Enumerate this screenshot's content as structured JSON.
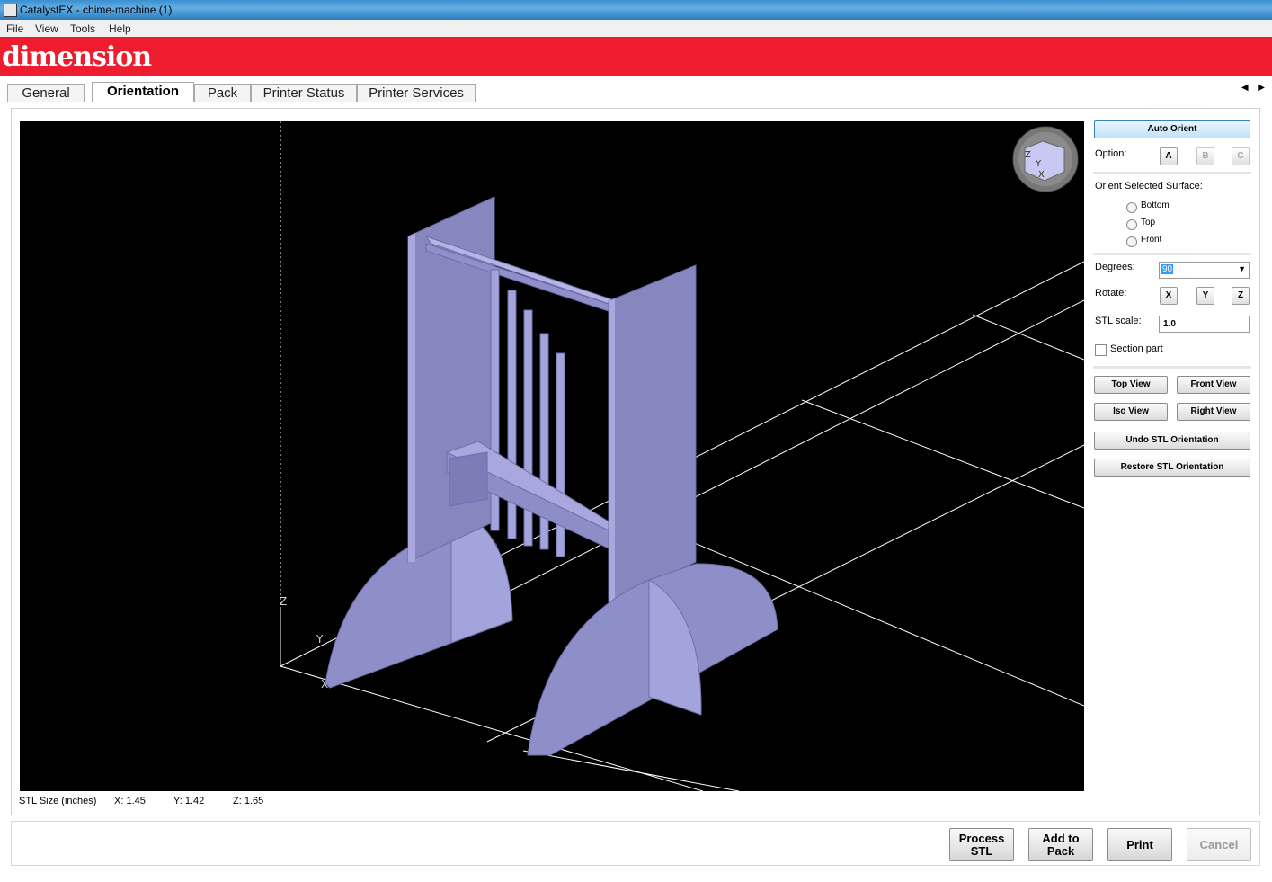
{
  "window": {
    "title": "CatalystEX - chime-machine (1)"
  },
  "menu": [
    "File",
    "View",
    "Tools",
    "Help"
  ],
  "brand": {
    "logo_text": "dimension"
  },
  "tabs": [
    "General",
    "Orientation",
    "Pack",
    "Printer Status",
    "Printer Services"
  ],
  "active_tab": "Orientation",
  "viewport": {
    "axis_labels": {
      "z": "Z",
      "y": "Y",
      "x": "X"
    },
    "cube_labels": [
      "Z",
      "Y",
      "X"
    ]
  },
  "stl_size": {
    "label": "STL Size (inches)",
    "x": "X:  1.45",
    "y": "Y:  1.42",
    "z": "Z:  1.65"
  },
  "panel": {
    "auto_orient": "Auto Orient",
    "option_label": "Option:",
    "options": [
      "A",
      "B",
      "C"
    ],
    "orient_surface_label": "Orient Selected Surface:",
    "surfaces": [
      "Bottom",
      "Top",
      "Front"
    ],
    "degrees_label": "Degrees:",
    "degrees_value": "90",
    "rotate_label": "Rotate:",
    "rotate_axes": [
      "X",
      "Y",
      "Z"
    ],
    "stl_scale_label": "STL scale:",
    "stl_scale_value": "1.0",
    "section_part": "Section part",
    "top_view": "Top View",
    "front_view": "Front View",
    "iso_view": "Iso View",
    "right_view": "Right View",
    "undo": "Undo STL Orientation",
    "restore": "Restore STL Orientation"
  },
  "bottom": {
    "process_l1": "Process",
    "process_l2": "STL",
    "add_l1": "Add to",
    "add_l2": "Pack",
    "print": "Print",
    "cancel": "Cancel"
  },
  "colors": {
    "brand_red": "#ee1c2e",
    "model": "#9a9ad6",
    "viewport_bg": "#000000"
  }
}
